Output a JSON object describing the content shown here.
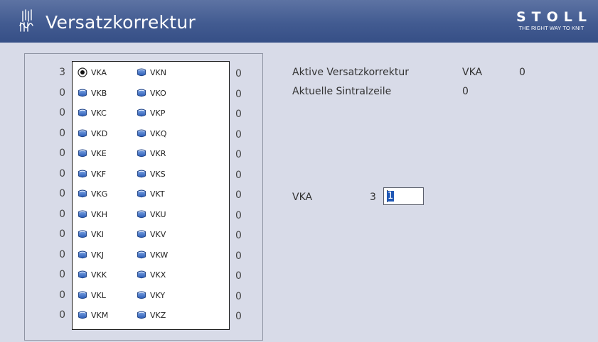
{
  "window": {
    "title": "Versatzkorrektur",
    "brand_name": "STOLL",
    "brand_tagline": "THE RIGHT WAY TO KNIT",
    "title_icon": "needle-bed-icon"
  },
  "colors": {
    "titlebar": "#425b91",
    "background": "#d8dbe8",
    "selection": "#1f57b5"
  },
  "list": {
    "left_values": [
      "3",
      "0",
      "0",
      "0",
      "0",
      "0",
      "0",
      "0",
      "0",
      "0",
      "0",
      "0",
      "0"
    ],
    "col1": [
      "VKA",
      "VKB",
      "VKC",
      "VKD",
      "VKE",
      "VKF",
      "VKG",
      "VKH",
      "VKI",
      "VKJ",
      "VKK",
      "VKL",
      "VKM"
    ],
    "col2": [
      "VKN",
      "VKO",
      "VKP",
      "VKQ",
      "VKR",
      "VKS",
      "VKT",
      "VKU",
      "VKV",
      "VKW",
      "VKX",
      "VKY",
      "VKZ"
    ],
    "right_values": [
      "0",
      "0",
      "0",
      "0",
      "0",
      "0",
      "0",
      "0",
      "0",
      "0",
      "0",
      "0",
      "0"
    ],
    "selected": "VKA"
  },
  "info": {
    "active_label": "Aktive Versatzkorrektur",
    "active_name": "VKA",
    "active_value": "0",
    "current_label": "Aktuelle Sintralzeile",
    "current_value": "0"
  },
  "editor": {
    "label": "VKA",
    "number": "3",
    "value": "1"
  }
}
